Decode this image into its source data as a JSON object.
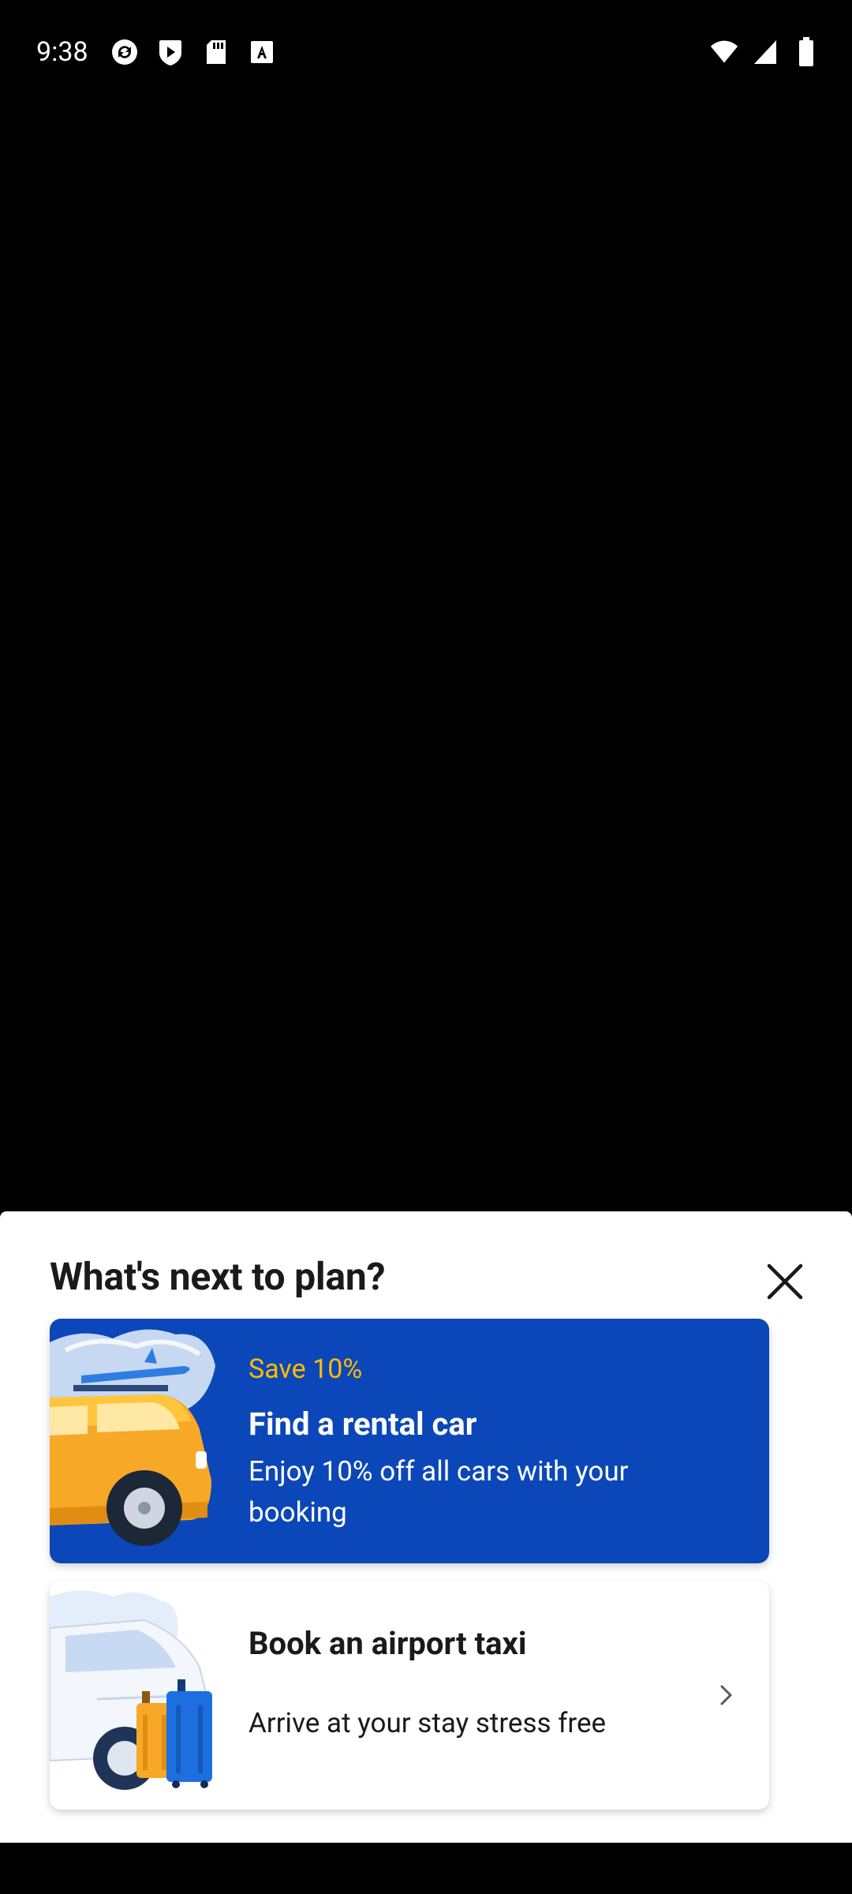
{
  "status_bar": {
    "time": "9:38",
    "left_icons": [
      "sync-icon",
      "play-store-icon",
      "sd-card-icon",
      "font-a-icon"
    ],
    "right_icons": [
      "wifi-icon",
      "signal-icon",
      "battery-icon"
    ]
  },
  "sheet": {
    "title": "What's next to plan?",
    "close_icon": "close-icon"
  },
  "cards": {
    "rental": {
      "eyebrow": "Save 10%",
      "title": "Find a rental car",
      "description": "Enjoy 10% off all cars with your booking",
      "illustration": "rental-car-illustration"
    },
    "taxi": {
      "title": "Book an airport taxi",
      "description": "Arrive at your stay stress free",
      "illustration": "airport-taxi-illustration",
      "chevron_icon": "chevron-right-icon"
    }
  },
  "colors": {
    "brand_blue": "#0b47b8",
    "accent_yellow": "#febb02",
    "sheet_bg": "#ffffff",
    "backdrop": "#000000"
  }
}
